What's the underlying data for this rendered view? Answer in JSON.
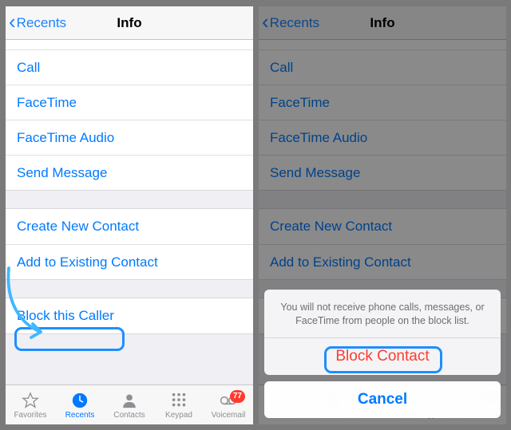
{
  "nav": {
    "back_label": "Recents",
    "title": "Info"
  },
  "actions_primary": [
    {
      "label": "Call"
    },
    {
      "label": "FaceTime"
    },
    {
      "label": "FaceTime Audio"
    },
    {
      "label": "Send Message"
    }
  ],
  "actions_contact": [
    {
      "label": "Create New Contact"
    },
    {
      "label": "Add to Existing Contact"
    }
  ],
  "actions_block": [
    {
      "label": "Block this Caller"
    }
  ],
  "tabs": [
    {
      "id": "favorites",
      "label": "Favorites",
      "active": false
    },
    {
      "id": "recents",
      "label": "Recents",
      "active": true
    },
    {
      "id": "contacts",
      "label": "Contacts",
      "active": false
    },
    {
      "id": "keypad",
      "label": "Keypad",
      "active": false
    },
    {
      "id": "voicemail",
      "label": "Voicemail",
      "active": false,
      "badge": "77"
    }
  ],
  "sheet": {
    "message": "You will not receive phone calls, messages, or FaceTime from people on the block list.",
    "block_label": "Block Contact",
    "cancel_label": "Cancel"
  }
}
